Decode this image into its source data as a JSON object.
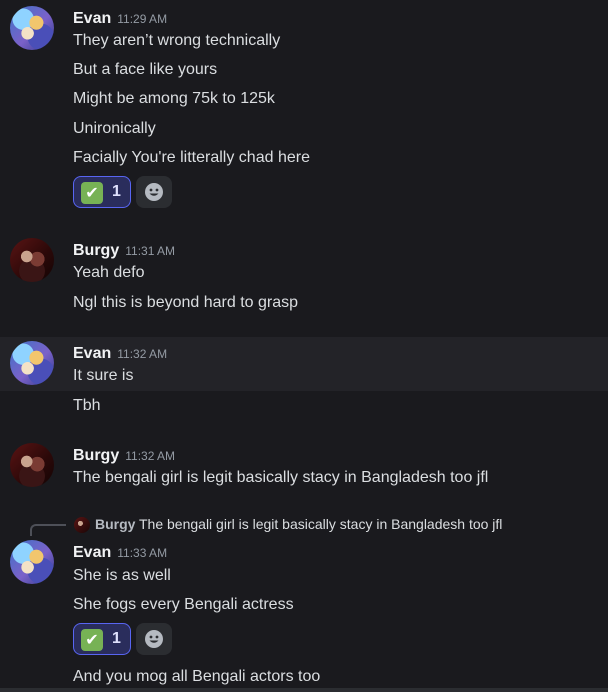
{
  "messages": [
    {
      "user": "Evan",
      "time": "11:29 AM",
      "lines": [
        "They aren’t wrong technically",
        "But a face like yours",
        "Might be among 75k to 125k",
        "Unironically",
        "Facially You're litterally chad here"
      ],
      "reaction": {
        "emoji": "✔",
        "count": "1"
      }
    },
    {
      "user": "Burgy",
      "time": "11:31 AM",
      "lines": [
        "Yeah defo",
        "Ngl this is beyond hard to grasp"
      ]
    },
    {
      "user": "Evan",
      "time": "11:32 AM",
      "lines": [
        "It sure is",
        "Tbh"
      ]
    },
    {
      "user": "Burgy",
      "time": "11:32 AM",
      "lines": [
        "The bengali girl is legit basically stacy in Bangladesh too jfl"
      ]
    },
    {
      "reply": {
        "user": "Burgy",
        "text": "The bengali girl is legit basically stacy in Bangladesh too jfl"
      },
      "user": "Evan",
      "time": "11:33 AM",
      "lines": [
        "She is as well",
        "She fogs every Bengali actress",
        "And you mog all Bengali actors too"
      ],
      "reaction": {
        "emoji": "✔",
        "count": "1"
      }
    }
  ],
  "icons": {
    "reaction": "check-mark-button-emoji",
    "add_reaction": "add-reaction-smile-icon"
  },
  "colors": {
    "background": "#1a1a1e",
    "highlight": "#232328",
    "reaction_border": "#5865f2",
    "check_green": "#77b255"
  }
}
